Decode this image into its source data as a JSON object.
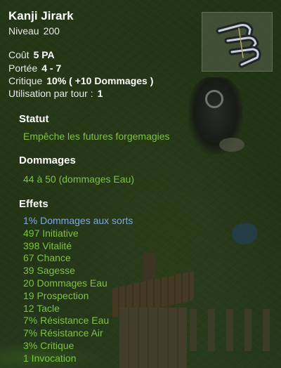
{
  "item": {
    "name": "Kanji Jirark",
    "level_label": "Niveau",
    "level_value": "200",
    "icon": "kanji-weapon-icon"
  },
  "stats": [
    {
      "label": "Coût",
      "value": "5 PA"
    },
    {
      "label": "Portée",
      "value": "4 - 7"
    },
    {
      "label": "Critique",
      "value": "10% ( +10 Dommages )"
    },
    {
      "label": "Utilisation par tour :",
      "value": "1"
    }
  ],
  "statut": {
    "title": "Statut",
    "text": "Empêche les futures forgemagies"
  },
  "dommages": {
    "title": "Dommages",
    "text": "44 à 50 (dommages Eau)"
  },
  "effets": {
    "title": "Effets",
    "items": [
      {
        "text": "1% Dommages aux sorts",
        "color": "#7fa8dc"
      },
      {
        "text": "497 Initiative",
        "color": "#7cc242"
      },
      {
        "text": "398 Vitalité",
        "color": "#7cc242"
      },
      {
        "text": "67 Chance",
        "color": "#7cc242"
      },
      {
        "text": "39 Sagesse",
        "color": "#7cc242"
      },
      {
        "text": "20 Dommages Eau",
        "color": "#7cc242"
      },
      {
        "text": "19 Prospection",
        "color": "#7cc242"
      },
      {
        "text": "12 Tacle",
        "color": "#7cc242"
      },
      {
        "text": "7% Résistance Eau",
        "color": "#7cc242"
      },
      {
        "text": "7% Résistance Air",
        "color": "#7cc242"
      },
      {
        "text": "3% Critique",
        "color": "#7cc242"
      },
      {
        "text": "1 Invocation",
        "color": "#7cc242"
      }
    ]
  },
  "colors": {
    "effect_green": "#7cc242",
    "effect_blue": "#7fa8dc",
    "text_white": "#ffffff"
  }
}
